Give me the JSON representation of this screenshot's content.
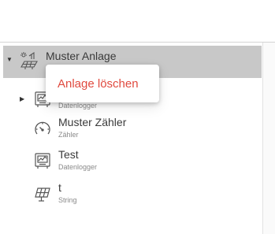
{
  "tree": {
    "root": {
      "title": "Muster Anlage",
      "icon": "solar-plant-icon"
    },
    "children": [
      {
        "title": "",
        "subtitle": "Datenlogger",
        "icon": "datalogger-icon",
        "expandable": true
      },
      {
        "title": "Muster Zähler",
        "subtitle": "Zähler",
        "icon": "meter-gauge-icon",
        "expandable": false
      },
      {
        "title": "Test",
        "subtitle": "Datenlogger",
        "icon": "datalogger-icon",
        "expandable": false
      },
      {
        "title": "t",
        "subtitle": "String",
        "icon": "solar-panel-icon",
        "expandable": false
      }
    ]
  },
  "context_menu": {
    "items": [
      {
        "label": "Anlage löschen"
      }
    ]
  },
  "colors": {
    "selected_row": "#c8c8c8",
    "danger_text": "#e04a3f"
  }
}
